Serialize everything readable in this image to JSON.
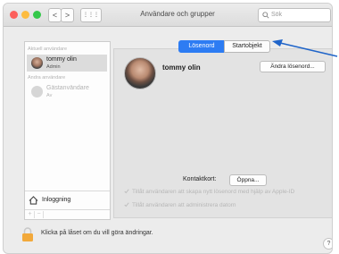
{
  "window": {
    "title": "Användare och grupper",
    "search_placeholder": "Sök"
  },
  "nav": {
    "back": "<",
    "forward": ">",
    "grid": "⋮⋮⋮"
  },
  "sidebar": {
    "current_user_header": "Aktuell användare",
    "current_user": {
      "name": "tommy olin",
      "role": "Admin"
    },
    "other_users_header": "Andra användare",
    "guest_user": {
      "name": "Gästanvändare",
      "status": "Av"
    },
    "login_options_label": "Inloggning",
    "add_label": "+",
    "remove_label": "−"
  },
  "tabs": [
    {
      "label": "Lösenord",
      "selected": true
    },
    {
      "label": "Startobjekt",
      "selected": false
    }
  ],
  "user": {
    "name": "tommy olin",
    "change_password_label": "Ändra lösenord..."
  },
  "contact": {
    "label": "Kontaktkort:",
    "open_label": "Öppna..."
  },
  "options": [
    {
      "label": "Tillåt användaren att skapa nytt lösenord med hjälp av Apple-ID",
      "checked": true
    },
    {
      "label": "Tillåt användaren att administrera datorn",
      "checked": true
    }
  ],
  "footer": {
    "lock_text": "Klicka på låset om du vill göra ändringar.",
    "help_label": "?"
  },
  "colors": {
    "accent": "#2d7cf3",
    "close": "#fc605c",
    "minimize": "#fdbc40",
    "zoom": "#34c84a",
    "arrow": "#1f64c9"
  }
}
